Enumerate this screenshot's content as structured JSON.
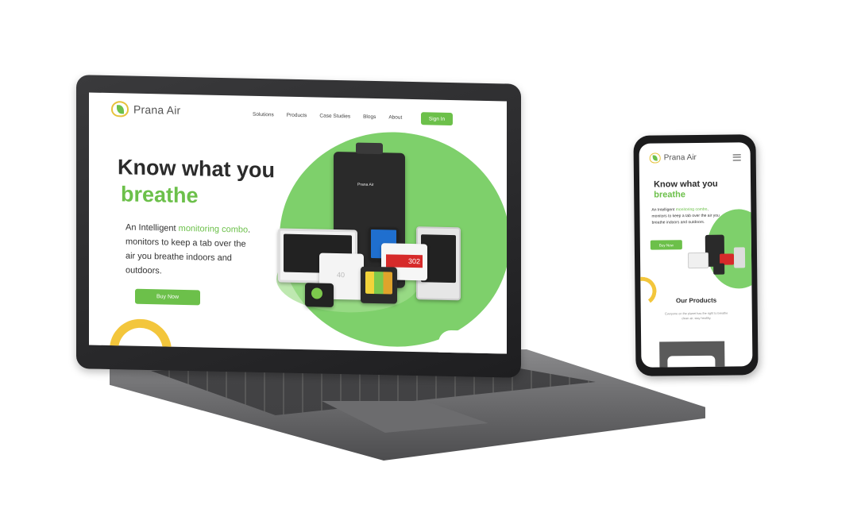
{
  "brand": {
    "name": "Prana Air"
  },
  "nav": {
    "items": [
      "Solutions",
      "Products",
      "Case Studies",
      "Blogs",
      "About"
    ],
    "signin_label": "Sign In"
  },
  "hero": {
    "title_line1": "Know what you",
    "title_line2": "breathe",
    "sub_prefix": "An Intelligent ",
    "sub_highlight": "monitoring combo",
    "sub_rest": ". monitors to keep a tab over the air you breathe indoors and outdoors.",
    "button_label": "Buy Now"
  },
  "devices": {
    "tower_label": "Prana Air",
    "display_value": "40",
    "red_display": "302"
  },
  "mobile": {
    "brand": "Prana Air",
    "title_line1": "Know what you",
    "title_line2": "breathe",
    "sub_prefix": "An Intelligent ",
    "sub_highlight": "monitoring combo",
    "sub_rest": ", monitors to keep a tab over the air you breathe indoors and outdoors.",
    "button_label": "Buy Now",
    "section_title": "Our Products",
    "section_sub": "Everyone on the planet has the right to breathe clean air, stay healthy."
  },
  "colors": {
    "accent": "#6cc04a",
    "brand_yellow": "#f3c63c",
    "device_dark": "#2a2a2a"
  }
}
